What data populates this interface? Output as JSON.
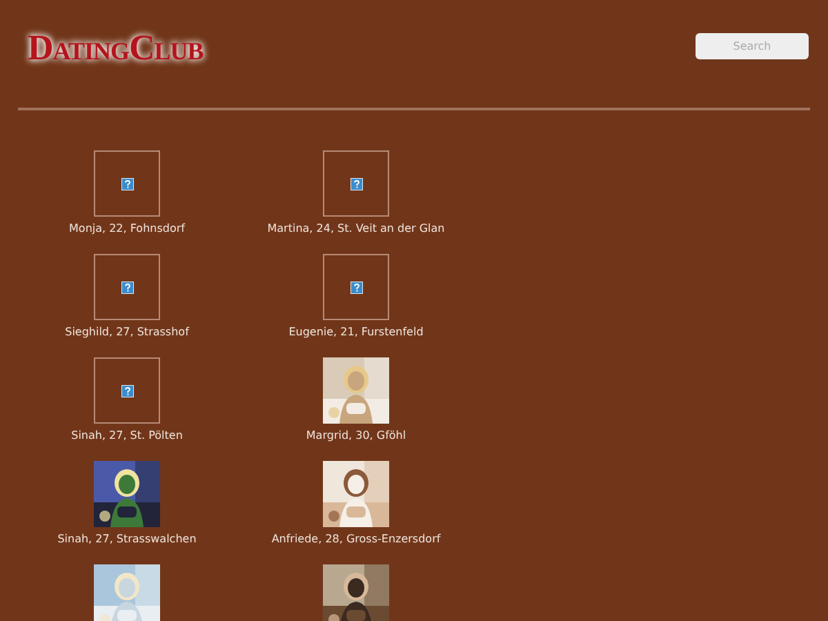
{
  "logo": "DatingClub",
  "search": {
    "placeholder": "Search"
  },
  "profiles": [
    {
      "kind": "broken",
      "caption": "Monja, 22, Fohnsdorf"
    },
    {
      "kind": "broken",
      "caption": "Martina, 24, St. Veit an der Glan"
    },
    {
      "kind": "broken",
      "caption": "Sieghild, 27, Strasshof"
    },
    {
      "kind": "broken",
      "caption": "Eugenie, 21, Furstenfeld"
    },
    {
      "kind": "broken",
      "caption": "Sinah, 27, St. Pölten"
    },
    {
      "kind": "picture",
      "caption": "Margrid, 30, Gföhl"
    },
    {
      "kind": "picture",
      "caption": "Sinah, 27, Strasswalchen"
    },
    {
      "kind": "picture",
      "caption": "Anfriede, 28, Gross-Enzersdorf"
    },
    {
      "kind": "picture"
    },
    {
      "kind": "picture"
    }
  ]
}
